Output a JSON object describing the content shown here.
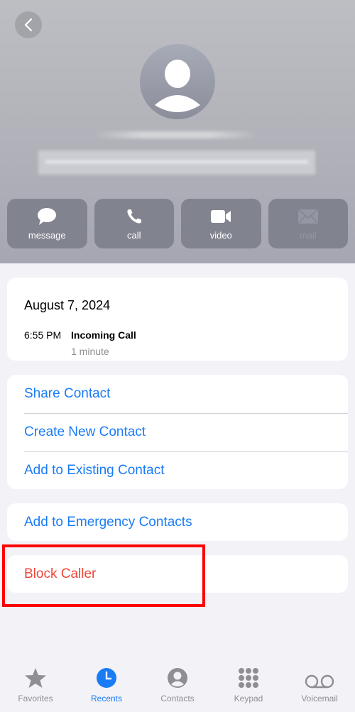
{
  "header": {
    "back_icon": "chevron-left-icon",
    "avatar_icon": "person-silhouette-icon",
    "contact_name": "",
    "contact_number": ""
  },
  "actions": [
    {
      "label": "message",
      "icon": "message-bubble-icon",
      "enabled": true
    },
    {
      "label": "call",
      "icon": "phone-icon",
      "enabled": true
    },
    {
      "label": "video",
      "icon": "video-camera-icon",
      "enabled": true
    },
    {
      "label": "mail",
      "icon": "envelope-icon",
      "enabled": false
    }
  ],
  "call_log": {
    "date": "August 7, 2024",
    "time": "6:55 PM",
    "type": "Incoming Call",
    "duration": "1 minute"
  },
  "options": {
    "share_contact": "Share Contact",
    "create_new_contact": "Create New Contact",
    "add_to_existing": "Add to Existing Contact",
    "add_to_emergency": "Add to Emergency Contacts",
    "block_caller": "Block Caller"
  },
  "tabbar": {
    "active": "Recents",
    "items": [
      {
        "label": "Favorites",
        "icon": "star-icon"
      },
      {
        "label": "Recents",
        "icon": "clock-icon"
      },
      {
        "label": "Contacts",
        "icon": "person-circle-icon"
      },
      {
        "label": "Keypad",
        "icon": "keypad-icon"
      },
      {
        "label": "Voicemail",
        "icon": "voicemail-icon"
      }
    ]
  },
  "colors": {
    "accent": "#1a7cf5",
    "destructive": "#f0463a",
    "highlight_box": "#ff0000",
    "background": "#f2f2f7"
  }
}
